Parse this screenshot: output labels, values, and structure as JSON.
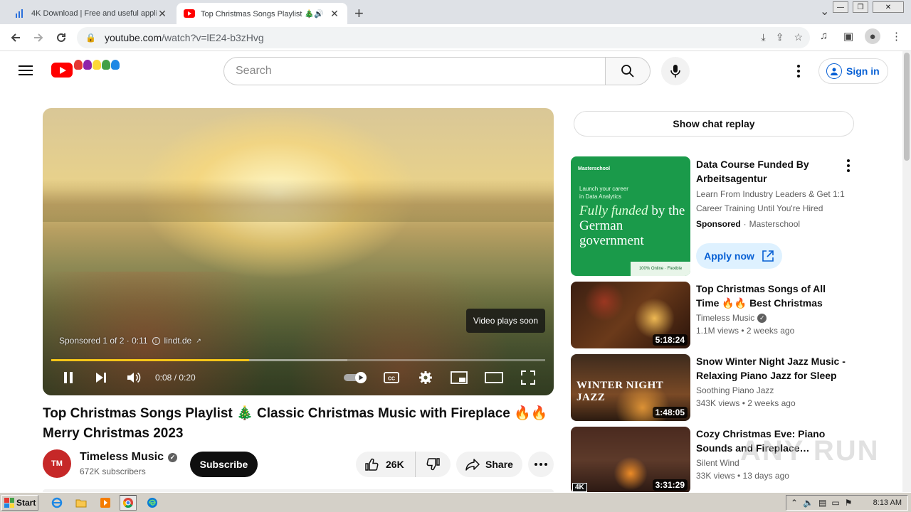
{
  "browser": {
    "tabs": [
      {
        "title": "4K Download | Free and useful appli",
        "active": false
      },
      {
        "title": "Top Christmas Songs Playlist 🎄",
        "active": true
      }
    ],
    "url_host": "youtube.com",
    "url_path": "/watch?v=lE24-b3zHvg"
  },
  "header": {
    "search_placeholder": "Search",
    "signin_label": "Sign in"
  },
  "player": {
    "sponsor_text": "Sponsored 1 of 2 · 0:11",
    "sponsor_link": "lindt.de",
    "overlay_text": "Video plays soon",
    "timecode": "0:08 / 0:20",
    "progress_played": 0.4,
    "progress_buffered": 0.6,
    "accent_color": "#f5c518"
  },
  "video": {
    "title": "Top Christmas Songs Playlist 🎄 Classic Christmas Music with Fireplace 🔥🔥 Merry Christmas 2023",
    "channel_name": "Timeless Music",
    "channel_avatar_text": "TM",
    "subscribers": "672K subscribers",
    "subscribe_label": "Subscribe",
    "likes": "26K",
    "share_label": "Share"
  },
  "sidebar": {
    "chat_replay_label": "Show chat replay",
    "ad": {
      "thumb_brand": "Masterschool",
      "thumb_tagline_1": "Launch your career",
      "thumb_tagline_2": "in Data Analytics",
      "thumb_headline_em": "Fully funded",
      "thumb_headline_rest": " by the German government",
      "thumb_footer": "100% Online · Flexible",
      "title": "Data Course Funded By Arbeitsagentur",
      "description": "Learn From Industry Leaders & Get 1:1 Career Training Until You're Hired",
      "sponsored_label": "Sponsored",
      "advertiser": "Masterschool",
      "cta_label": "Apply now"
    },
    "recommendations": [
      {
        "title": "Top Christmas Songs of All Time 🔥🔥 Best Christmas Musi…",
        "channel": "Timeless Music",
        "verified": true,
        "meta": "1.1M views • 2 weeks ago",
        "duration": "5:18:24"
      },
      {
        "title": "Snow Winter Night Jazz Music - Relaxing Piano Jazz for Sleep …",
        "channel": "Soothing Piano Jazz",
        "verified": false,
        "meta": "343K views • 2 weeks ago",
        "duration": "1:48:05",
        "thumb_text": "WINTER NIGHT JAZZ"
      },
      {
        "title": "Cozy Christmas Eve: Piano Sounds and Fireplace…",
        "channel": "Silent Wind",
        "verified": false,
        "meta": "33K views • 13 days ago",
        "duration": "3:31:29",
        "badge": "4K"
      }
    ]
  },
  "watermark": "ANY RUN",
  "taskbar": {
    "start_label": "Start",
    "clock": "8:13 AM"
  }
}
